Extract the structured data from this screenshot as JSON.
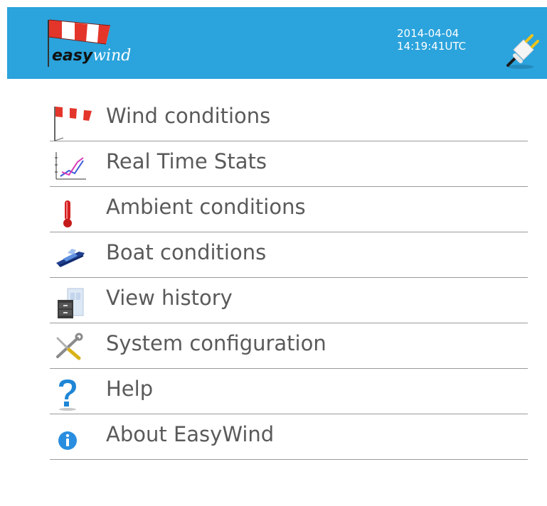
{
  "header": {
    "logo": {
      "easy": "easy",
      "wind": "wind"
    },
    "date": "2014-04-04",
    "time": "14:19:41UTC",
    "connection_icon": "plug-icon"
  },
  "menu": {
    "items": [
      {
        "label": "Wind conditions",
        "icon": "windsock-icon"
      },
      {
        "label": "Real Time Stats",
        "icon": "line-chart-icon"
      },
      {
        "label": "Ambient conditions",
        "icon": "thermometer-icon"
      },
      {
        "label": "Boat conditions",
        "icon": "boat-icon"
      },
      {
        "label": "View history",
        "icon": "archive-icon"
      },
      {
        "label": "System configuration",
        "icon": "tools-icon"
      },
      {
        "label": "Help",
        "icon": "help-icon"
      },
      {
        "label": "About EasyWind",
        "icon": "info-icon"
      }
    ]
  },
  "colors": {
    "header_bg": "#2ba3dc",
    "menu_text": "#5a5a5a",
    "divider": "#9a9a9a"
  }
}
